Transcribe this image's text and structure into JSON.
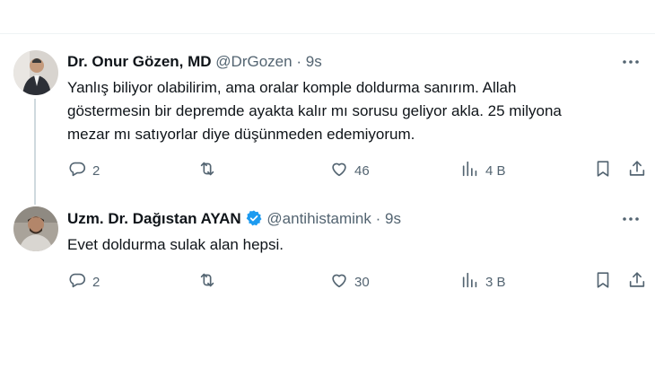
{
  "tweets": [
    {
      "name": "Dr. Onur Gözen, MD",
      "handle": "@DrGozen",
      "separator": "·",
      "time": "9s",
      "text": "Yanlış biliyor olabilirim, ama oralar komple doldurma sanırım. Allah\ngöstermesin bir depremde ayakta kalır mı sorusu geliyor akla. 25 milyona\nmezar mı satıyorlar diye düşünmeden edemiyorum.",
      "replies": "2",
      "retweets": "",
      "likes": "46",
      "views": "4 B",
      "verified": false
    },
    {
      "name": "Uzm. Dr. Dağıstan AYAN",
      "handle": "@antihistamink",
      "separator": "·",
      "time": "9s",
      "text": "Evet doldurma sulak alan hepsi.",
      "replies": "2",
      "retweets": "",
      "likes": "30",
      "views": "3 B",
      "verified": true
    }
  ],
  "colors": {
    "text": "#0f1419",
    "secondary": "#536471",
    "verified": "#1d9bf0",
    "divider": "#eff3f4",
    "thread_line": "#cfd9de"
  },
  "icons": [
    "more-icon",
    "reply-icon",
    "retweet-icon",
    "like-icon",
    "views-icon",
    "bookmark-icon",
    "share-icon",
    "verified-badge-icon"
  ]
}
